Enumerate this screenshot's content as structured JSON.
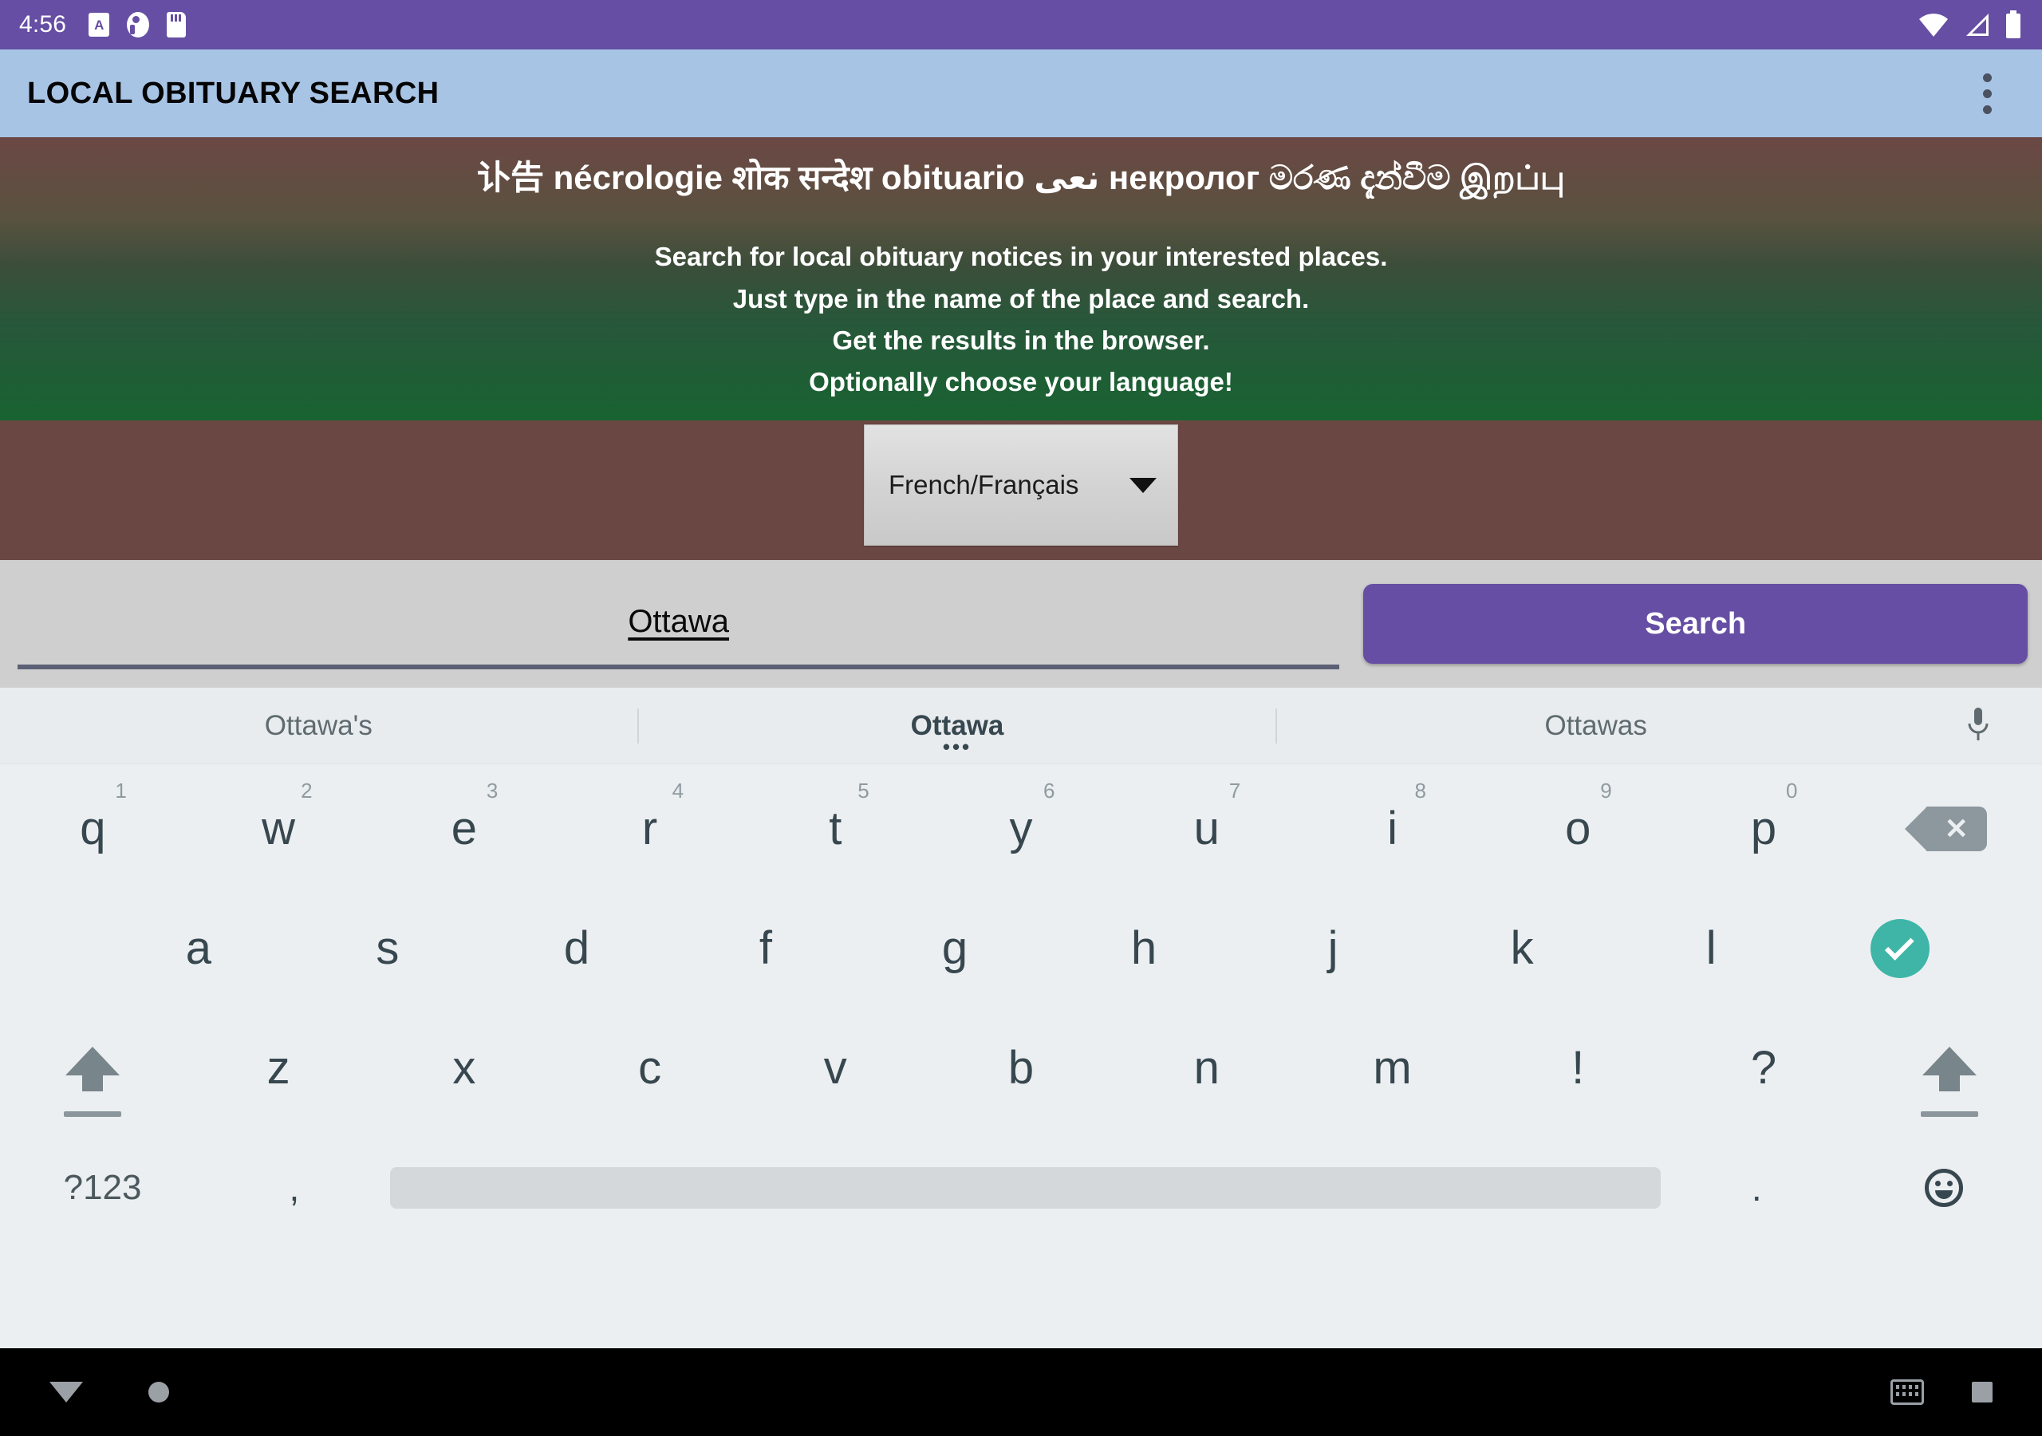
{
  "status_bar": {
    "clock": "4:56",
    "left_icons": [
      "alarm-card-icon",
      "volume-icon",
      "sd-card-icon"
    ],
    "right_icons": [
      "wifi-icon",
      "cell-signal-icon",
      "battery-icon"
    ],
    "background_color": "#654ea3"
  },
  "app_bar": {
    "title": "LOCAL OBITUARY SEARCH",
    "overflow_icon": "overflow-menu-icon",
    "background_color": "#a8c4e5"
  },
  "banner": {
    "heading": "讣告 nécrologie शोक सन्देश obituario نعی некролог මරණ දැන්වීම இறப்பு",
    "lines": [
      "Search for local obituary notices in your interested places.",
      "Just type in the name of the place and search.",
      "Get the results in the browser.",
      "Optionally choose your language!"
    ],
    "gradient_from": "#6b4744",
    "gradient_to": "#186331"
  },
  "language_select": {
    "value": "French/Français",
    "caret_icon": "chevron-down-icon",
    "band_color": "#6b4744"
  },
  "search": {
    "input_value": "Ottawa",
    "input_placeholder": "",
    "button_label": "Search",
    "button_color": "#654ea3",
    "row_background": "#cfcfcf"
  },
  "keyboard": {
    "suggestions": [
      {
        "text": "Ottawa's",
        "active": false
      },
      {
        "text": "Ottawa",
        "active": true,
        "dots": "•••"
      },
      {
        "text": "Ottawas",
        "active": false
      }
    ],
    "mic_icon": "microphone-icon",
    "row1": [
      {
        "key": "q",
        "num": "1"
      },
      {
        "key": "w",
        "num": "2"
      },
      {
        "key": "e",
        "num": "3"
      },
      {
        "key": "r",
        "num": "4"
      },
      {
        "key": "t",
        "num": "5"
      },
      {
        "key": "y",
        "num": "6"
      },
      {
        "key": "u",
        "num": "7"
      },
      {
        "key": "i",
        "num": "8"
      },
      {
        "key": "o",
        "num": "9"
      },
      {
        "key": "p",
        "num": "0"
      }
    ],
    "backspace_icon": "backspace-icon",
    "row2": [
      {
        "key": "a"
      },
      {
        "key": "s"
      },
      {
        "key": "d"
      },
      {
        "key": "f"
      },
      {
        "key": "g"
      },
      {
        "key": "h"
      },
      {
        "key": "j"
      },
      {
        "key": "k"
      },
      {
        "key": "l"
      }
    ],
    "enter_icon": "checkmark-enter-icon",
    "enter_color": "#3fb5a7",
    "row3": [
      {
        "key": "z"
      },
      {
        "key": "x"
      },
      {
        "key": "c"
      },
      {
        "key": "v"
      },
      {
        "key": "b"
      },
      {
        "key": "n"
      },
      {
        "key": "m"
      },
      {
        "key": "!"
      },
      {
        "key": "?"
      }
    ],
    "shift_icon": "shift-icon",
    "row4": {
      "symbols_label": "?123",
      "comma": ",",
      "space": "",
      "period": ".",
      "emoji_icon": "emoji-smiley-icon"
    },
    "background_color": "#eceff1"
  },
  "nav_bar": {
    "back_icon": "back-triangle-icon",
    "home_icon": "home-circle-icon",
    "keyboard_icon": "keyboard-indicator-icon",
    "recents_icon": "recents-square-icon",
    "background_color": "#000000"
  }
}
